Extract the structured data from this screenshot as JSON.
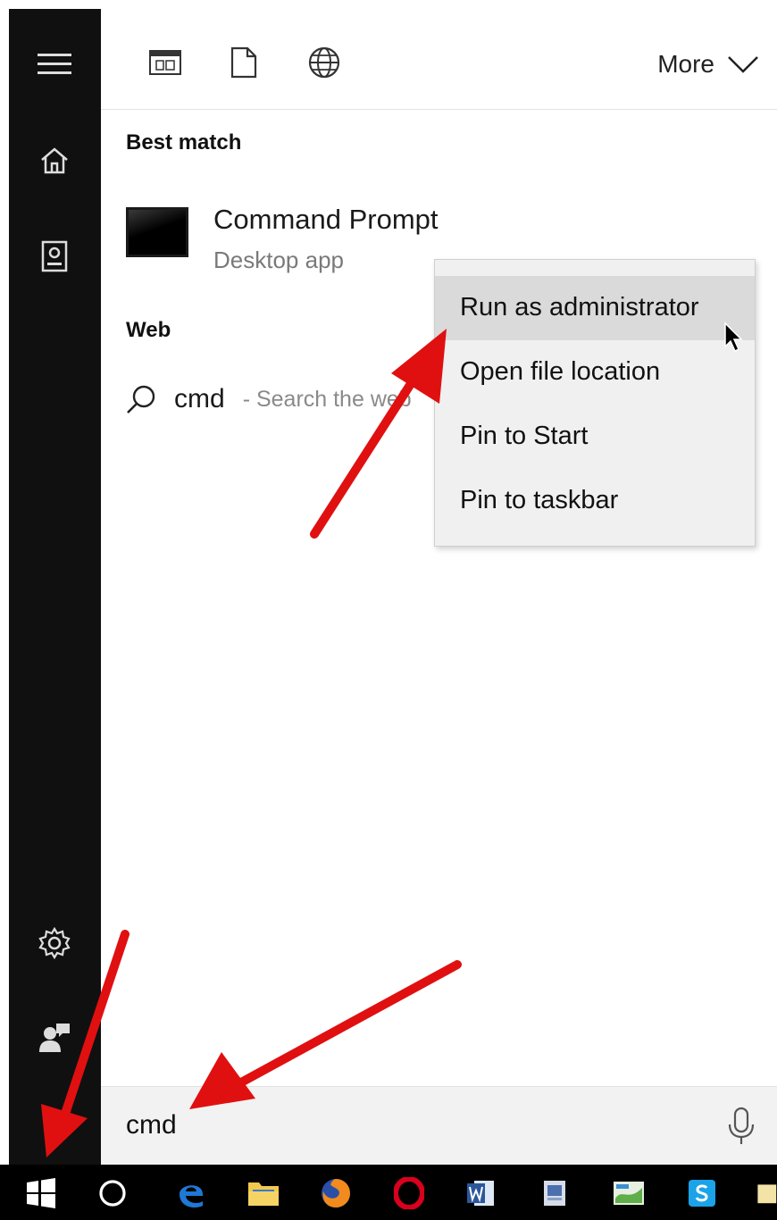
{
  "toolbar": {
    "icons": [
      "apps-filter-icon",
      "documents-filter-icon",
      "web-filter-icon"
    ],
    "more_label": "More"
  },
  "left_rail": {
    "icons": [
      "menu-icon",
      "home-icon",
      "notebook-icon",
      "settings-icon",
      "feedback-icon"
    ]
  },
  "results": {
    "best_match_heading": "Best match",
    "best_match": {
      "name": "Command Prompt",
      "kind": "Desktop app"
    },
    "web_heading": "Web",
    "web_item": {
      "query": "cmd",
      "suffix": "- Search the web"
    }
  },
  "context_menu": {
    "items": [
      {
        "label": "Run as administrator",
        "hovered": true
      },
      {
        "label": "Open file location",
        "hovered": false
      },
      {
        "label": "Pin to Start",
        "hovered": false
      },
      {
        "label": "Pin to taskbar",
        "hovered": false
      }
    ]
  },
  "search": {
    "value": "cmd"
  },
  "taskbar": {
    "items": [
      "windows-start-icon",
      "cortana-icon",
      "edge-icon",
      "file-explorer-icon",
      "firefox-icon",
      "opera-icon",
      "word-icon",
      "app-icon",
      "app-icon-2",
      "skype-icon",
      "folder-icon"
    ]
  },
  "colors": {
    "rail_bg": "#101010",
    "menu_bg": "#f0f0f0",
    "menu_hover": "#dadada",
    "annotation_arrow": "#e01010",
    "edge_blue": "#1e78d4",
    "skype_blue": "#1aa3e8",
    "word_blue": "#2b579a",
    "opera_red": "#d8001c"
  }
}
